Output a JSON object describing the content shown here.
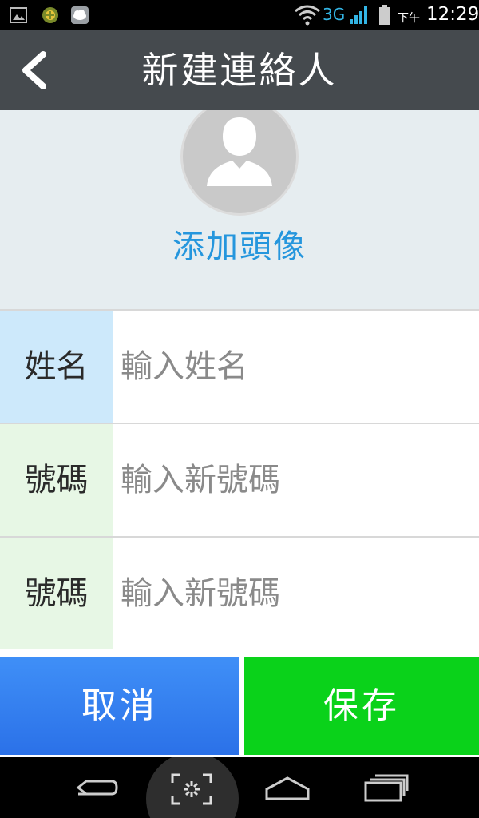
{
  "status_bar": {
    "network": "3G",
    "ampm": "下午",
    "time": "12:29"
  },
  "header": {
    "title": "新建連絡人"
  },
  "avatar": {
    "label": "添加頭像"
  },
  "form": {
    "rows": [
      {
        "label": "姓名",
        "placeholder": "輸入姓名"
      },
      {
        "label": "號碼",
        "placeholder": "輸入新號碼"
      },
      {
        "label": "號碼",
        "placeholder": "輸入新號碼"
      }
    ]
  },
  "actions": {
    "cancel_label": "取消",
    "save_label": "保存"
  },
  "colors": {
    "header_bg": "#454a4e",
    "accent_blue": "#2596dd",
    "cancel_bg": "#2b71e8",
    "save_bg": "#0ad21a"
  },
  "icons": {
    "header_back": "chevron-left-icon",
    "nav": [
      "back-icon",
      "screenshot-icon",
      "home-icon",
      "recent-apps-icon"
    ]
  }
}
